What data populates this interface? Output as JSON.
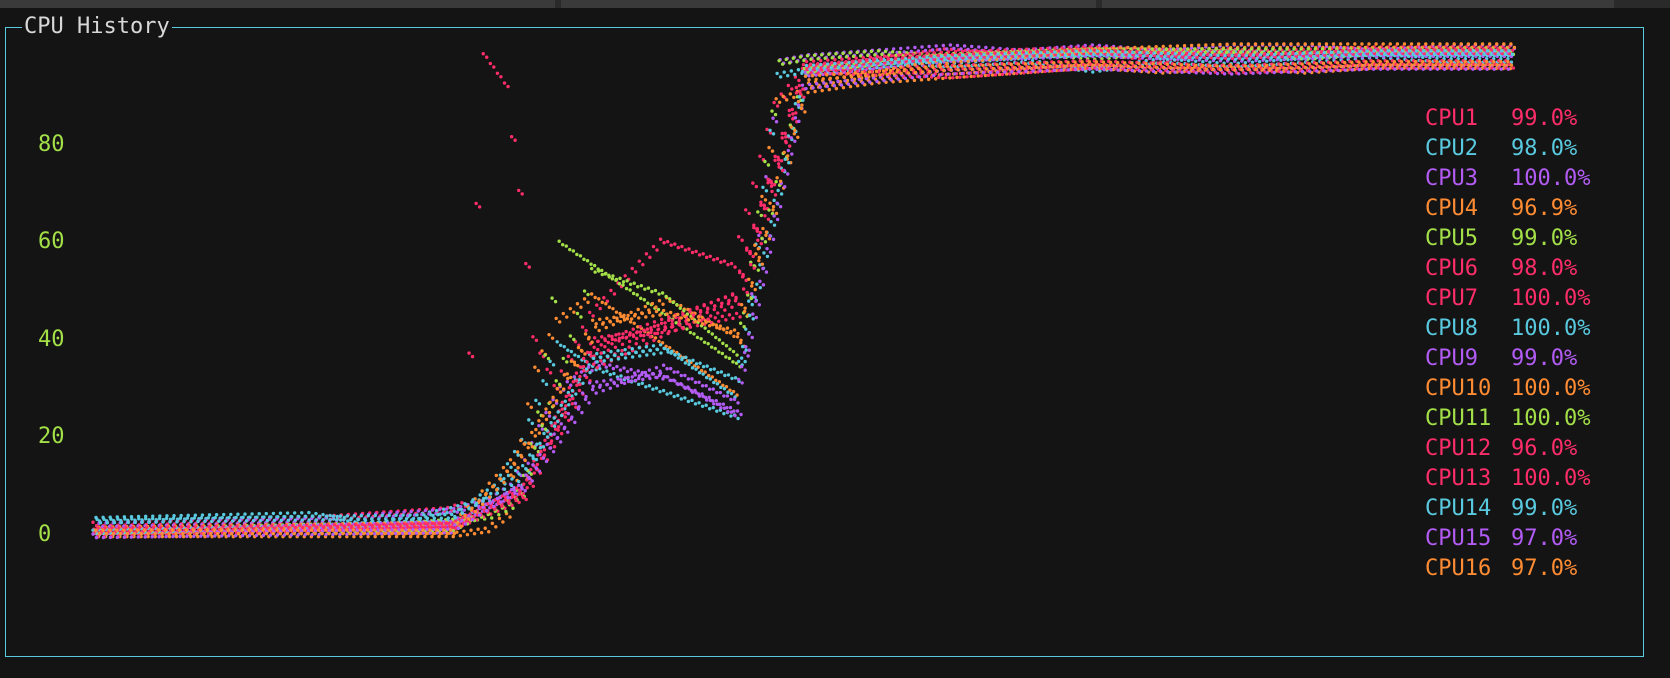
{
  "window": {
    "title": "CPU History"
  },
  "theme": {
    "border": "#59c9df",
    "axis": "#a3e048",
    "background": "#141414"
  },
  "chart_data": {
    "type": "scatter",
    "title": "CPU History",
    "xlabel": "",
    "ylabel": "",
    "yticks": [
      "80",
      "60",
      "40",
      "20",
      "0"
    ],
    "ylim": [
      0,
      100
    ],
    "legend_position": "right",
    "series": [
      {
        "name": "CPU1",
        "color": "#ff2d6a",
        "current": "99.0%",
        "x": [
          0,
          30,
          40,
          50,
          52,
          55,
          58,
          60,
          62,
          65,
          70,
          80,
          90,
          96,
          100,
          110,
          120,
          130,
          140,
          150,
          160,
          170,
          180,
          190,
          200
        ],
        "y": [
          2,
          3,
          4,
          5,
          6,
          98,
          92,
          70,
          40,
          30,
          45,
          60,
          55,
          88,
          95,
          97,
          99,
          98,
          99,
          97,
          99,
          98,
          99,
          99,
          99
        ]
      },
      {
        "name": "CPU2",
        "color": "#59c9df",
        "current": "98.0%",
        "x": [
          0,
          30,
          40,
          50,
          55,
          58,
          60,
          62,
          65,
          70,
          80,
          90,
          96,
          100,
          110,
          120,
          130,
          140,
          150,
          160,
          170,
          180,
          190,
          200
        ],
        "y": [
          4,
          5,
          3,
          6,
          8,
          15,
          20,
          28,
          40,
          35,
          30,
          25,
          95,
          96,
          98,
          97,
          98,
          96,
          98,
          97,
          98,
          99,
          98,
          98
        ]
      },
      {
        "name": "CPU3",
        "color": "#b35cf5",
        "current": "100.0%",
        "x": [
          0,
          30,
          40,
          50,
          55,
          58,
          60,
          62,
          65,
          70,
          80,
          90,
          96,
          100,
          110,
          120,
          130,
          140,
          150,
          160,
          170,
          180,
          190,
          200
        ],
        "y": [
          2,
          3,
          4,
          5,
          7,
          10,
          15,
          22,
          30,
          35,
          32,
          25,
          97,
          98,
          99,
          100,
          99,
          100,
          99,
          100,
          100,
          99,
          100,
          100
        ]
      },
      {
        "name": "CPU4",
        "color": "#ff8c32",
        "current": "96.9%",
        "x": [
          0,
          30,
          40,
          50,
          55,
          58,
          60,
          62,
          65,
          70,
          80,
          90,
          96,
          100,
          110,
          120,
          130,
          140,
          150,
          160,
          170,
          180,
          190,
          200
        ],
        "y": [
          1,
          1,
          1,
          1,
          2,
          5,
          20,
          35,
          45,
          50,
          40,
          30,
          90,
          92,
          94,
          95,
          96,
          97,
          96,
          97,
          96,
          97,
          97,
          96.9
        ]
      },
      {
        "name": "CPU5",
        "color": "#a3e048",
        "current": "99.0%",
        "x": [
          0,
          30,
          40,
          50,
          55,
          58,
          60,
          62,
          65,
          70,
          80,
          90,
          96,
          100,
          110,
          120,
          130,
          140,
          150,
          160,
          170,
          180,
          190,
          200
        ],
        "y": [
          1,
          2,
          2,
          3,
          4,
          6,
          12,
          25,
          60,
          55,
          45,
          35,
          97,
          98,
          99,
          98,
          99,
          98,
          99,
          99,
          98,
          99,
          99,
          99
        ]
      },
      {
        "name": "CPU6",
        "color": "#ff2d6a",
        "current": "98.0%",
        "x": [
          0,
          50,
          60,
          70,
          80,
          90,
          100,
          120,
          140,
          160,
          180,
          200
        ],
        "y": [
          2,
          3,
          10,
          40,
          45,
          50,
          96,
          97,
          98,
          97,
          98,
          98
        ]
      },
      {
        "name": "CPU7",
        "color": "#ff2d6a",
        "current": "100.0%",
        "x": [
          0,
          50,
          60,
          70,
          80,
          90,
          100,
          120,
          140,
          160,
          180,
          200
        ],
        "y": [
          1,
          2,
          8,
          35,
          42,
          48,
          97,
          99,
          100,
          99,
          100,
          100
        ]
      },
      {
        "name": "CPU8",
        "color": "#59c9df",
        "current": "100.0%",
        "x": [
          0,
          50,
          60,
          70,
          80,
          90,
          100,
          120,
          140,
          160,
          180,
          200
        ],
        "y": [
          2,
          4,
          12,
          38,
          40,
          30,
          96,
          99,
          100,
          100,
          100,
          100
        ]
      },
      {
        "name": "CPU9",
        "color": "#b35cf5",
        "current": "99.0%",
        "x": [
          0,
          50,
          60,
          70,
          80,
          90,
          100,
          120,
          140,
          160,
          180,
          200
        ],
        "y": [
          1,
          3,
          10,
          30,
          35,
          28,
          95,
          98,
          99,
          98,
          99,
          99
        ]
      },
      {
        "name": "CPU10",
        "color": "#ff8c32",
        "current": "100.0%",
        "x": [
          0,
          50,
          60,
          70,
          80,
          90,
          100,
          120,
          140,
          160,
          180,
          200
        ],
        "y": [
          1,
          2,
          18,
          42,
          48,
          40,
          92,
          97,
          99,
          100,
          100,
          100
        ]
      },
      {
        "name": "CPU11",
        "color": "#a3e048",
        "current": "100.0%",
        "x": [
          0,
          50,
          60,
          70,
          80,
          90,
          100,
          120,
          140,
          160,
          180,
          200
        ],
        "y": [
          1,
          2,
          9,
          55,
          50,
          38,
          96,
          99,
          100,
          100,
          100,
          100
        ]
      },
      {
        "name": "CPU12",
        "color": "#ff2d6a",
        "current": "96.0%",
        "x": [
          0,
          50,
          60,
          70,
          80,
          90,
          100,
          120,
          140,
          160,
          180,
          200
        ],
        "y": [
          1,
          2,
          10,
          40,
          42,
          45,
          95,
          94,
          96,
          95,
          96,
          96
        ]
      },
      {
        "name": "CPU13",
        "color": "#ff2d6a",
        "current": "100.0%",
        "x": [
          0,
          50,
          60,
          70,
          80,
          90,
          100,
          120,
          140,
          160,
          180,
          200
        ],
        "y": [
          1,
          3,
          9,
          38,
          44,
          50,
          97,
          99,
          100,
          99,
          100,
          100
        ]
      },
      {
        "name": "CPU14",
        "color": "#59c9df",
        "current": "99.0%",
        "x": [
          0,
          50,
          60,
          70,
          80,
          90,
          100,
          120,
          140,
          160,
          180,
          200
        ],
        "y": [
          3,
          4,
          14,
          36,
          38,
          32,
          96,
          98,
          99,
          98,
          99,
          99
        ]
      },
      {
        "name": "CPU15",
        "color": "#b35cf5",
        "current": "97.0%",
        "x": [
          0,
          50,
          60,
          70,
          80,
          90,
          100,
          120,
          140,
          160,
          180,
          200
        ],
        "y": [
          1,
          2,
          11,
          32,
          34,
          26,
          93,
          96,
          97,
          96,
          97,
          97
        ]
      },
      {
        "name": "CPU16",
        "color": "#ff8c32",
        "current": "97.0%",
        "x": [
          0,
          50,
          60,
          70,
          80,
          90,
          100,
          120,
          140,
          160,
          180,
          200
        ],
        "y": [
          1,
          1,
          16,
          44,
          46,
          42,
          94,
          96,
          97,
          96,
          97,
          97
        ]
      }
    ]
  }
}
